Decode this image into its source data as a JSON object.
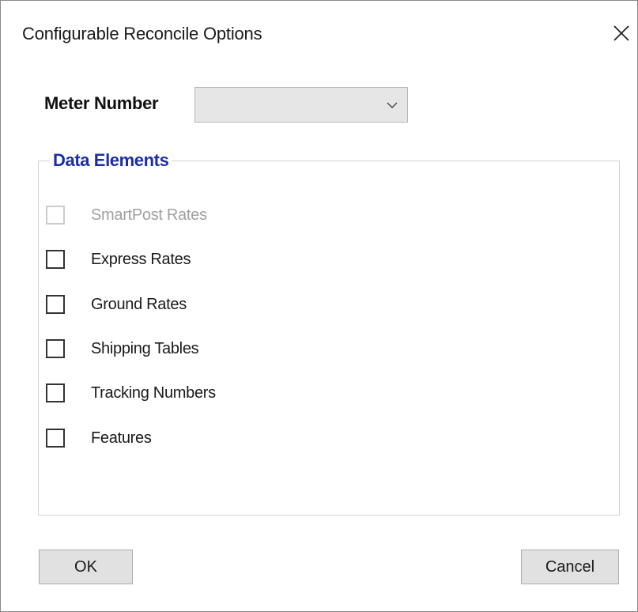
{
  "dialog": {
    "title": "Configurable Reconcile Options"
  },
  "meter": {
    "label": "Meter Number",
    "selected_value": ""
  },
  "data_elements": {
    "title": "Data Elements",
    "items": [
      {
        "label": "SmartPost Rates",
        "checked": false,
        "enabled": false
      },
      {
        "label": "Express Rates",
        "checked": false,
        "enabled": true
      },
      {
        "label": "Ground Rates",
        "checked": false,
        "enabled": true
      },
      {
        "label": "Shipping Tables",
        "checked": false,
        "enabled": true
      },
      {
        "label": "Tracking Numbers",
        "checked": false,
        "enabled": true
      },
      {
        "label": "Features",
        "checked": false,
        "enabled": true
      }
    ]
  },
  "buttons": {
    "ok_label": "OK",
    "cancel_label": "Cancel"
  },
  "colors": {
    "group_title": "#1a2ea8",
    "disabled_text": "#a0a0a0",
    "button_bg": "#e1e1e1",
    "combobox_bg": "#e6e6e6"
  },
  "icons": {
    "close": "close-icon",
    "dropdown": "chevron-down-icon"
  }
}
